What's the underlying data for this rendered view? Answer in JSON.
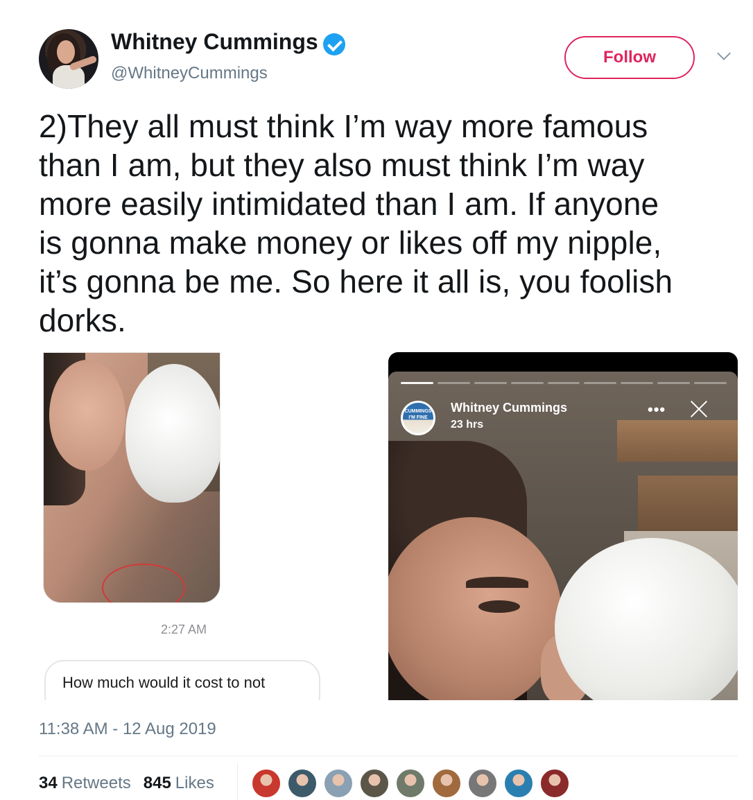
{
  "author": {
    "name": "Whitney Cummings",
    "handle": "@WhitneyCummings",
    "verified": true
  },
  "actions": {
    "follow_label": "Follow"
  },
  "tweet": {
    "text": "2)They all must think I’m way more famous\nthan I am, but they also must think I’m way\nmore easily intimidated than I am. If anyone\nis gonna make money or likes off my nipple,\nit’s gonna be me. So here it all is, you foolish\ndorks.",
    "timestamp": "11:38 AM - 12 Aug 2019"
  },
  "media_left": {
    "message_time": "2:27 AM",
    "bubble_text": "How much would it cost to not"
  },
  "media_right": {
    "story_name": "Whitney Cummings",
    "story_time": "23 hrs",
    "more_label": "•••",
    "book_text": "CUMMINGS I'M FINE",
    "progress_segments": 9,
    "active_segment": 1
  },
  "stats": {
    "retweets_count": "34",
    "retweets_label": "Retweets",
    "likes_count": "845",
    "likes_label": "Likes"
  },
  "likers": [
    {
      "icon": "santa-avatar",
      "color": "#c8382e"
    },
    {
      "icon": "user-avatar",
      "color": "#3d5a6b"
    },
    {
      "icon": "user-avatar",
      "color": "#8aa1b4"
    },
    {
      "icon": "user-avatar",
      "color": "#5b5648"
    },
    {
      "icon": "user-avatar",
      "color": "#6f7a6a"
    },
    {
      "icon": "user-avatar",
      "color": "#a06a3e"
    },
    {
      "icon": "user-avatar",
      "color": "#777777"
    },
    {
      "icon": "user-avatar",
      "color": "#2b7fb0"
    },
    {
      "icon": "user-avatar",
      "color": "#8a2a2a"
    }
  ],
  "colors": {
    "follow_accent": "#e0245e",
    "verified_blue": "#1da1f2",
    "secondary_text": "#657786"
  }
}
